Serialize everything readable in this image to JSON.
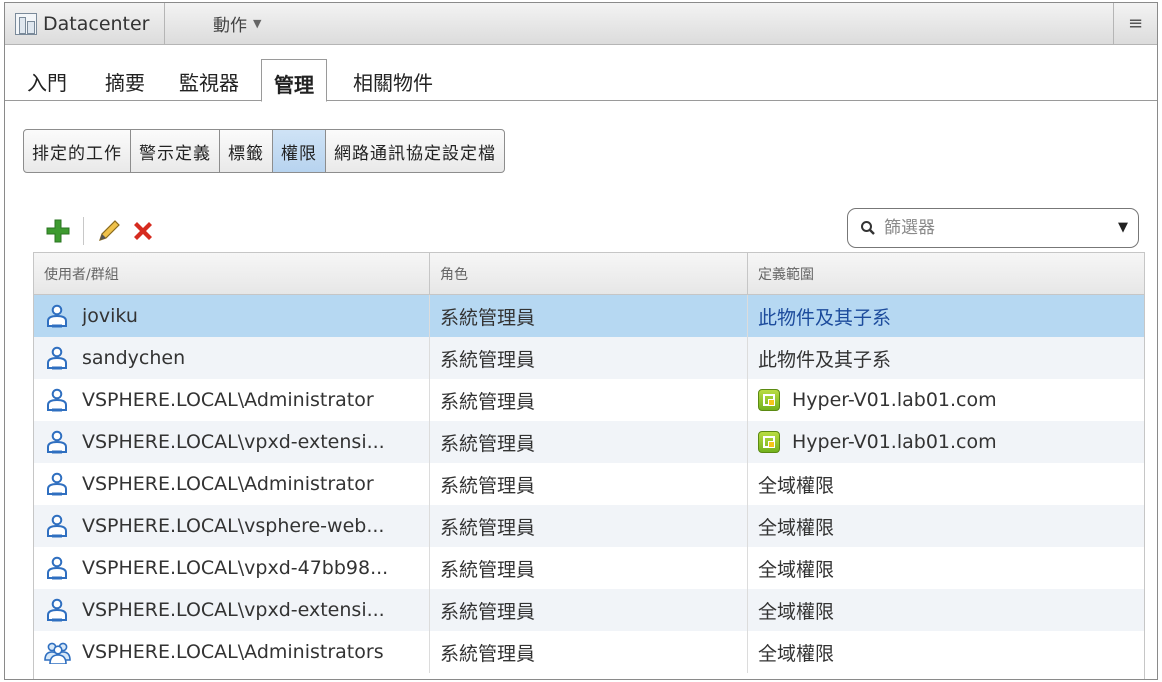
{
  "header": {
    "title": "Datacenter",
    "action_label": "動作",
    "action_caret": "▼",
    "menu_glyph": "≡"
  },
  "tabs": [
    {
      "label": "入門"
    },
    {
      "label": "摘要"
    },
    {
      "label": "監視器"
    },
    {
      "label": "管理",
      "active": true
    },
    {
      "label": "相關物件"
    }
  ],
  "subtabs": [
    {
      "label": "排定的工作"
    },
    {
      "label": "警示定義"
    },
    {
      "label": "標籤"
    },
    {
      "label": "權限",
      "active": true
    },
    {
      "label": "網路通訊協定設定檔"
    }
  ],
  "filter": {
    "placeholder": "篩選器",
    "dropdown_glyph": "▼"
  },
  "table": {
    "headers": [
      "使用者/群組",
      "角色",
      "定義範圍"
    ],
    "rows": [
      {
        "user": "joviku",
        "role": "系統管理員",
        "scope": "此物件及其子系",
        "user_icon": "user-icon",
        "scope_icon": "",
        "selected": true
      },
      {
        "user": "sandychen",
        "role": "系統管理員",
        "scope": "此物件及其子系",
        "user_icon": "user-icon",
        "scope_icon": ""
      },
      {
        "user": "VSPHERE.LOCAL\\Administrator",
        "role": "系統管理員",
        "scope": "Hyper-V01.lab01.com",
        "user_icon": "user-icon",
        "scope_icon": "host-icon"
      },
      {
        "user": "VSPHERE.LOCAL\\vpxd-extensi...",
        "role": "系統管理員",
        "scope": "Hyper-V01.lab01.com",
        "user_icon": "user-icon",
        "scope_icon": "host-icon"
      },
      {
        "user": "VSPHERE.LOCAL\\Administrator",
        "role": "系統管理員",
        "scope": "全域權限",
        "user_icon": "user-icon",
        "scope_icon": ""
      },
      {
        "user": "VSPHERE.LOCAL\\vsphere-web...",
        "role": "系統管理員",
        "scope": "全域權限",
        "user_icon": "user-icon",
        "scope_icon": ""
      },
      {
        "user": "VSPHERE.LOCAL\\vpxd-47bb98...",
        "role": "系統管理員",
        "scope": "全域權限",
        "user_icon": "user-icon",
        "scope_icon": ""
      },
      {
        "user": "VSPHERE.LOCAL\\vpxd-extensi...",
        "role": "系統管理員",
        "scope": "全域權限",
        "user_icon": "user-icon",
        "scope_icon": ""
      },
      {
        "user": "VSPHERE.LOCAL\\Administrators",
        "role": "系統管理員",
        "scope": "全域權限",
        "user_icon": "group-icon",
        "scope_icon": ""
      }
    ]
  },
  "colors": {
    "selected_row": "#b6d8f2",
    "add_icon": "#3d9a2f",
    "delete_icon": "#d62b1f",
    "user_icon": "#2f6fc0"
  }
}
